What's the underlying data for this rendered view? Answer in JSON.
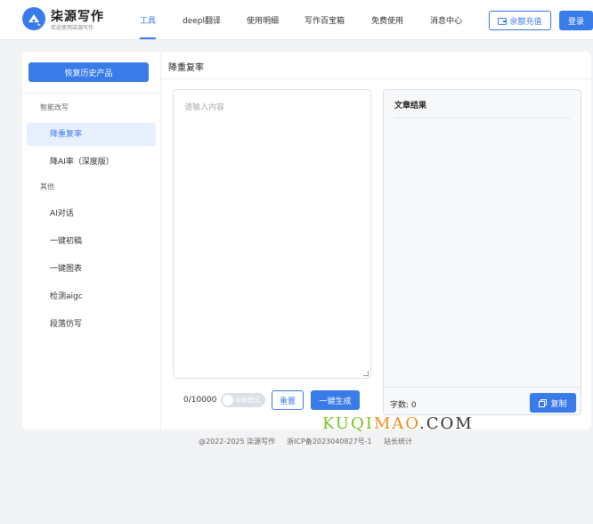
{
  "brand": {
    "name": "柒源写作",
    "slogan": "欢迎使用柒源写作",
    "accent_color": "#3a7bea",
    "logo_icon": "pen-bubble-icon"
  },
  "nav": {
    "items": [
      {
        "label": "工具",
        "active": true
      },
      {
        "label": "deepl翻译",
        "active": false
      },
      {
        "label": "使用明细",
        "active": false
      },
      {
        "label": "写作百宝箱",
        "active": false
      },
      {
        "label": "免费使用",
        "active": false
      },
      {
        "label": "消息中心",
        "active": false
      }
    ],
    "recharge_label": "余额充值",
    "recharge_icon": "wallet-icon",
    "login_label": "登录"
  },
  "sidebar": {
    "restore_label": "恢复历史产品",
    "groups": [
      {
        "title": "智能改写",
        "items": [
          {
            "label": "降重复率",
            "active": true
          },
          {
            "label": "降AI率（深度版）",
            "active": false
          }
        ]
      },
      {
        "title": "其他",
        "items": [
          {
            "label": "AI对话",
            "active": false
          },
          {
            "label": "一键初稿",
            "active": false
          },
          {
            "label": "一键图表",
            "active": false
          },
          {
            "label": "检测aigc",
            "active": false
          },
          {
            "label": "段落仿写",
            "active": false
          }
        ]
      }
    ]
  },
  "main": {
    "title": "降重复率",
    "input_placeholder": "请输入内容",
    "input_value": "",
    "counter": "0/10000",
    "toggle_label": "非限模式",
    "toggle_on": false,
    "reset_label": "重置",
    "generate_label": "一键生成"
  },
  "result": {
    "title": "文章结果",
    "body": "",
    "word_count": "字数: 0",
    "copy_label": "复制",
    "copy_icon": "copy-icon"
  },
  "watermark": {
    "part1": "KUQI",
    "part2": "MAO",
    "part3": ".COM"
  },
  "footer": {
    "copyright": "@2022-2025 柒源写作",
    "icp": "浙ICP备2023040827号-1",
    "stats": "站长统计"
  }
}
